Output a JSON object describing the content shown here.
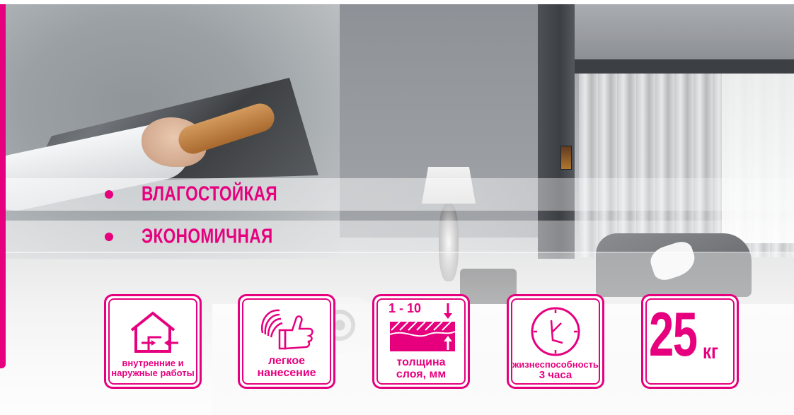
{
  "bullets": [
    {
      "label": "ВЛАГОСТОЙКАЯ"
    },
    {
      "label": "ЭКОНОМИЧНАЯ"
    }
  ],
  "features": [
    {
      "icon": "house-arrows-icon",
      "line1": "внутренние и",
      "line2": "наружные работы"
    },
    {
      "icon": "thumbs-up-hand-icon",
      "line1": "легкое",
      "line2": "нанесение"
    },
    {
      "icon": "layer-thickness-icon",
      "range": "1 - 10",
      "line1": "толщина",
      "line2": "слоя, мм"
    },
    {
      "icon": "clock-icon",
      "line1": "жизнеспособность",
      "line2": "3 часа"
    }
  ],
  "weight": {
    "value": "25",
    "unit": "кг"
  },
  "colors": {
    "accent": "#e6007e",
    "card_bg": "#ffffff"
  }
}
